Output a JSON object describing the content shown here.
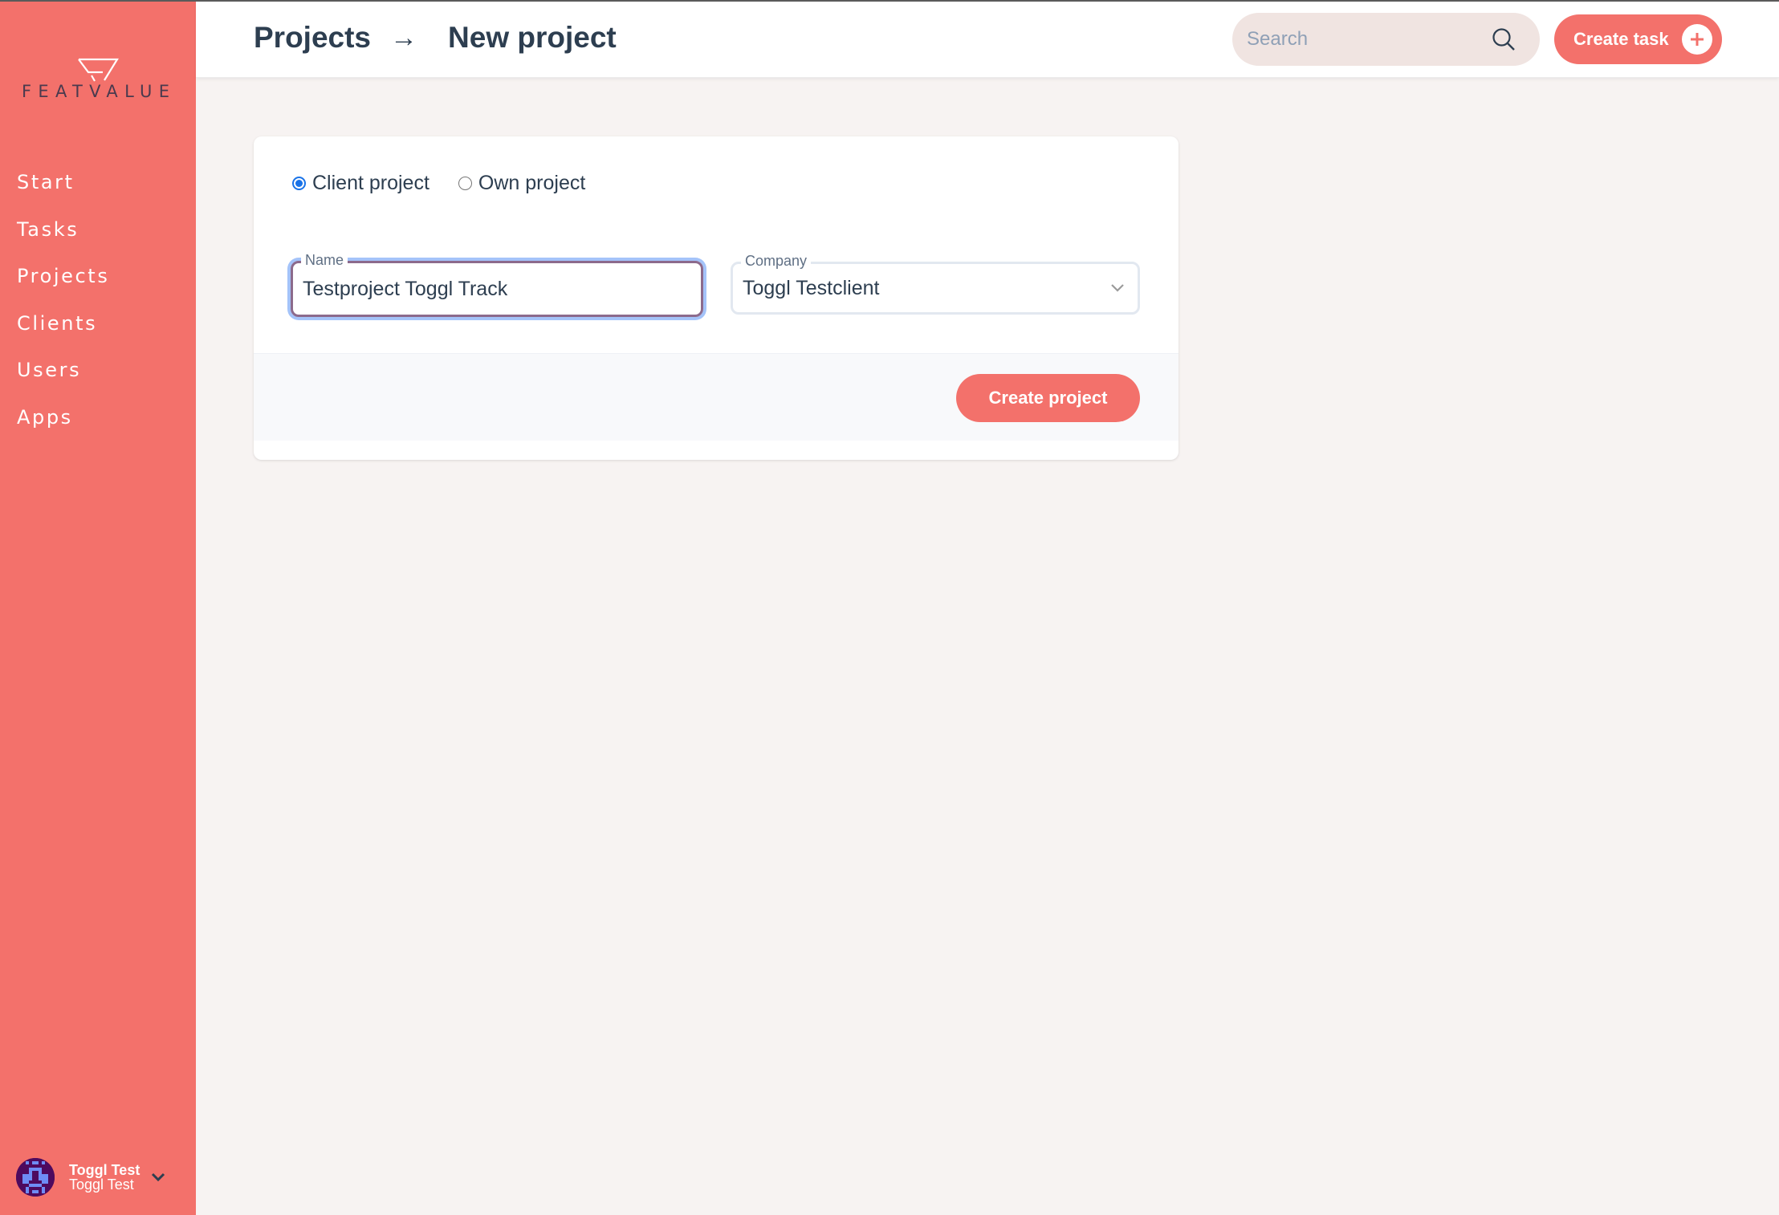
{
  "brand": {
    "name": "FEATVALUE",
    "colors": {
      "accent": "#f3716b",
      "text_dark": "#2d3e50",
      "background": "#f7f3f2"
    }
  },
  "sidebar": {
    "items": [
      {
        "label": "Start"
      },
      {
        "label": "Tasks"
      },
      {
        "label": "Projects"
      },
      {
        "label": "Clients"
      },
      {
        "label": "Users"
      },
      {
        "label": "Apps"
      }
    ],
    "user": {
      "name": "Toggl Test",
      "subtitle": "Toggl Test",
      "avatar_icon": "pixel-avatar-icon",
      "menu_icon": "chevron-down-icon"
    }
  },
  "header": {
    "breadcrumb": {
      "parent": "Projects",
      "separator": "→",
      "current": "New project"
    },
    "search": {
      "placeholder": "Search",
      "value": "",
      "icon": "search-icon"
    },
    "create_task_label": "Create task",
    "create_task_icon": "plus-circle-icon"
  },
  "form": {
    "project_type": {
      "options": [
        {
          "label": "Client project",
          "checked": true
        },
        {
          "label": "Own project",
          "checked": false
        }
      ]
    },
    "name": {
      "label": "Name",
      "value": "Testproject Toggl Track"
    },
    "company": {
      "label": "Company",
      "value": "Toggl Testclient",
      "icon": "chevron-down-icon"
    },
    "submit_label": "Create project"
  }
}
